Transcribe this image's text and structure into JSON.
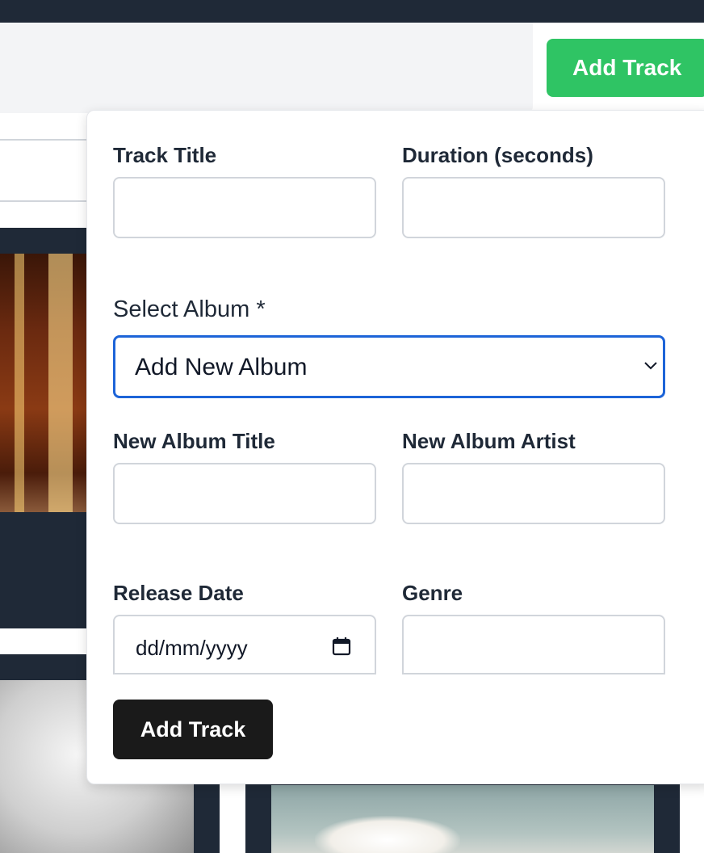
{
  "header": {
    "add_track_label": "Add Track"
  },
  "form": {
    "track_title_label": "Track Title",
    "duration_label": "Duration (seconds)",
    "select_album_label": "Select Album *",
    "select_album_value": "Add New Album",
    "new_album_title_label": "New Album Title",
    "new_album_artist_label": "New Album Artist",
    "release_date_label": "Release Date",
    "release_date_placeholder": "dd/mm/yyyy",
    "genre_label": "Genre",
    "submit_label": "Add Track"
  },
  "colors": {
    "top_bar": "#1f2937",
    "add_track_accent": "#2fc464",
    "select_focus": "#1d64d8",
    "submit_button": "#1a1a1a"
  },
  "icons": {
    "select_chevron": "chevron-down-icon",
    "date_picker": "calendar-icon"
  }
}
